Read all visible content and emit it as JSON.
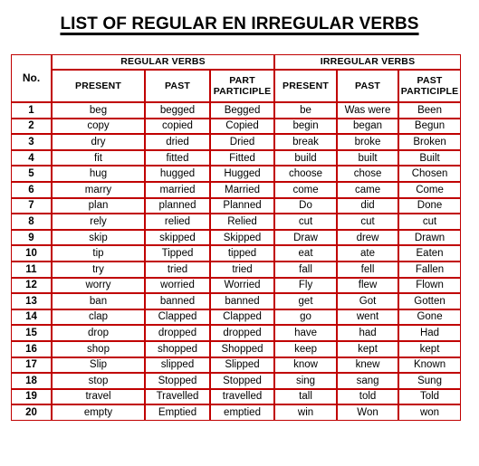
{
  "page": {
    "title": "LIST OF REGULAR EN IRREGULAR VERBS"
  },
  "colors": {
    "border_red": "#C00000",
    "header_fill_pink": "#DB9A9A",
    "text": "#000000",
    "background": "#FFFFFF"
  },
  "table": {
    "no_header": "No.",
    "groups": [
      {
        "label": "REGULAR VERBS",
        "span": 3
      },
      {
        "label": "IRREGULAR VERBS",
        "span": 3
      }
    ],
    "subheaders": [
      "PRESENT",
      "PAST",
      "PART PARTICIPLE",
      "PRESENT",
      "PAST",
      "PAST PARTICIPLE"
    ],
    "rows": [
      {
        "no": "1",
        "reg_present": "beg",
        "reg_past": "begged",
        "reg_part": "Begged",
        "irr_present": "be",
        "irr_past": "Was were",
        "irr_part": "Been"
      },
      {
        "no": "2",
        "reg_present": "copy",
        "reg_past": "copied",
        "reg_part": "Copied",
        "irr_present": "begin",
        "irr_past": "began",
        "irr_part": "Begun"
      },
      {
        "no": "3",
        "reg_present": "dry",
        "reg_past": "dried",
        "reg_part": "Dried",
        "irr_present": "break",
        "irr_past": "broke",
        "irr_part": "Broken"
      },
      {
        "no": "4",
        "reg_present": "fit",
        "reg_past": "fitted",
        "reg_part": "Fitted",
        "irr_present": "build",
        "irr_past": "built",
        "irr_part": "Built"
      },
      {
        "no": "5",
        "reg_present": "hug",
        "reg_past": "hugged",
        "reg_part": "Hugged",
        "irr_present": "choose",
        "irr_past": "chose",
        "irr_part": "Chosen"
      },
      {
        "no": "6",
        "reg_present": "marry",
        "reg_past": "married",
        "reg_part": "Married",
        "irr_present": "come",
        "irr_past": "came",
        "irr_part": "Come"
      },
      {
        "no": "7",
        "reg_present": "plan",
        "reg_past": "planned",
        "reg_part": "Planned",
        "irr_present": "Do",
        "irr_past": "did",
        "irr_part": "Done"
      },
      {
        "no": "8",
        "reg_present": "rely",
        "reg_past": "relied",
        "reg_part": "Relied",
        "irr_present": "cut",
        "irr_past": "cut",
        "irr_part": "cut"
      },
      {
        "no": "9",
        "reg_present": "skip",
        "reg_past": "skipped",
        "reg_part": "Skipped",
        "irr_present": "Draw",
        "irr_past": "drew",
        "irr_part": "Drawn"
      },
      {
        "no": "10",
        "reg_present": "tip",
        "reg_past": "Tipped",
        "reg_part": "tipped",
        "irr_present": "eat",
        "irr_past": "ate",
        "irr_part": "Eaten"
      },
      {
        "no": "11",
        "reg_present": "try",
        "reg_past": "tried",
        "reg_part": "tried",
        "irr_present": "fall",
        "irr_past": "fell",
        "irr_part": "Fallen"
      },
      {
        "no": "12",
        "reg_present": "worry",
        "reg_past": "worried",
        "reg_part": "Worried",
        "irr_present": "Fly",
        "irr_past": "flew",
        "irr_part": "Flown"
      },
      {
        "no": "13",
        "reg_present": "ban",
        "reg_past": "banned",
        "reg_part": "banned",
        "irr_present": "get",
        "irr_past": "Got",
        "irr_part": "Gotten"
      },
      {
        "no": "14",
        "reg_present": "clap",
        "reg_past": "Clapped",
        "reg_part": "Clapped",
        "irr_present": "go",
        "irr_past": "went",
        "irr_part": "Gone"
      },
      {
        "no": "15",
        "reg_present": "drop",
        "reg_past": "dropped",
        "reg_part": "dropped",
        "irr_present": "have",
        "irr_past": "had",
        "irr_part": "Had"
      },
      {
        "no": "16",
        "reg_present": "shop",
        "reg_past": "shopped",
        "reg_part": "Shopped",
        "irr_present": "keep",
        "irr_past": "kept",
        "irr_part": "kept"
      },
      {
        "no": "17",
        "reg_present": "Slip",
        "reg_past": "slipped",
        "reg_part": "Slipped",
        "irr_present": "know",
        "irr_past": "knew",
        "irr_part": "Known"
      },
      {
        "no": "18",
        "reg_present": "stop",
        "reg_past": "Stopped",
        "reg_part": "Stopped",
        "irr_present": "sing",
        "irr_past": "sang",
        "irr_part": "Sung"
      },
      {
        "no": "19",
        "reg_present": "travel",
        "reg_past": "Travelled",
        "reg_part": "travelled",
        "irr_present": "tall",
        "irr_past": "told",
        "irr_part": "Told"
      },
      {
        "no": "20",
        "reg_present": "empty",
        "reg_past": "Emptied",
        "reg_part": "emptied",
        "irr_present": "win",
        "irr_past": "Won",
        "irr_part": "won"
      }
    ]
  }
}
